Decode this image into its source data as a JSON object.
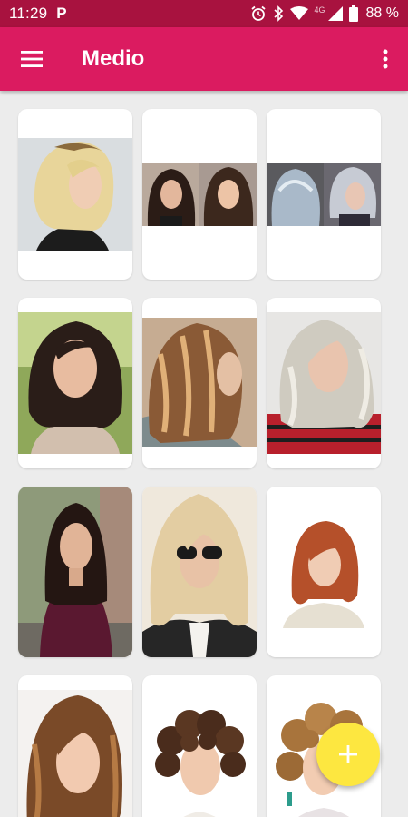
{
  "status_bar": {
    "time": "11:29",
    "app_notification_icon": "P",
    "network_type": "4G",
    "battery_percent": "88 %",
    "icons": [
      "alarm-icon",
      "bluetooth-icon",
      "wifi-icon",
      "cellular-icon",
      "battery-icon"
    ]
  },
  "app_bar": {
    "title": "Medio",
    "menu_icon": "hamburger-menu-icon",
    "overflow_icon": "more-vert-icon"
  },
  "gallery": {
    "items": [
      {
        "subject": "blonde lob with dark roots"
      },
      {
        "subject": "dark brown lob, two-photo collage"
      },
      {
        "subject": "silver wavy bob, two-photo collage"
      },
      {
        "subject": "dark brown shoulder-length waves"
      },
      {
        "subject": "caramel balayage waves"
      },
      {
        "subject": "ash blonde waves, red striped top"
      },
      {
        "subject": "sleek dark lob, burgundy top"
      },
      {
        "subject": "shaggy blonde cut with sunglasses"
      },
      {
        "subject": "copper red layered bob"
      },
      {
        "subject": "brown bob with highlights"
      },
      {
        "subject": "short curly bob"
      },
      {
        "subject": "curly blonde layered cut"
      }
    ]
  },
  "fab": {
    "icon": "plus-icon"
  },
  "colors": {
    "status_bar": "#a8123f",
    "app_bar": "#db1b60",
    "background": "#ececec",
    "fab": "#fde740"
  }
}
